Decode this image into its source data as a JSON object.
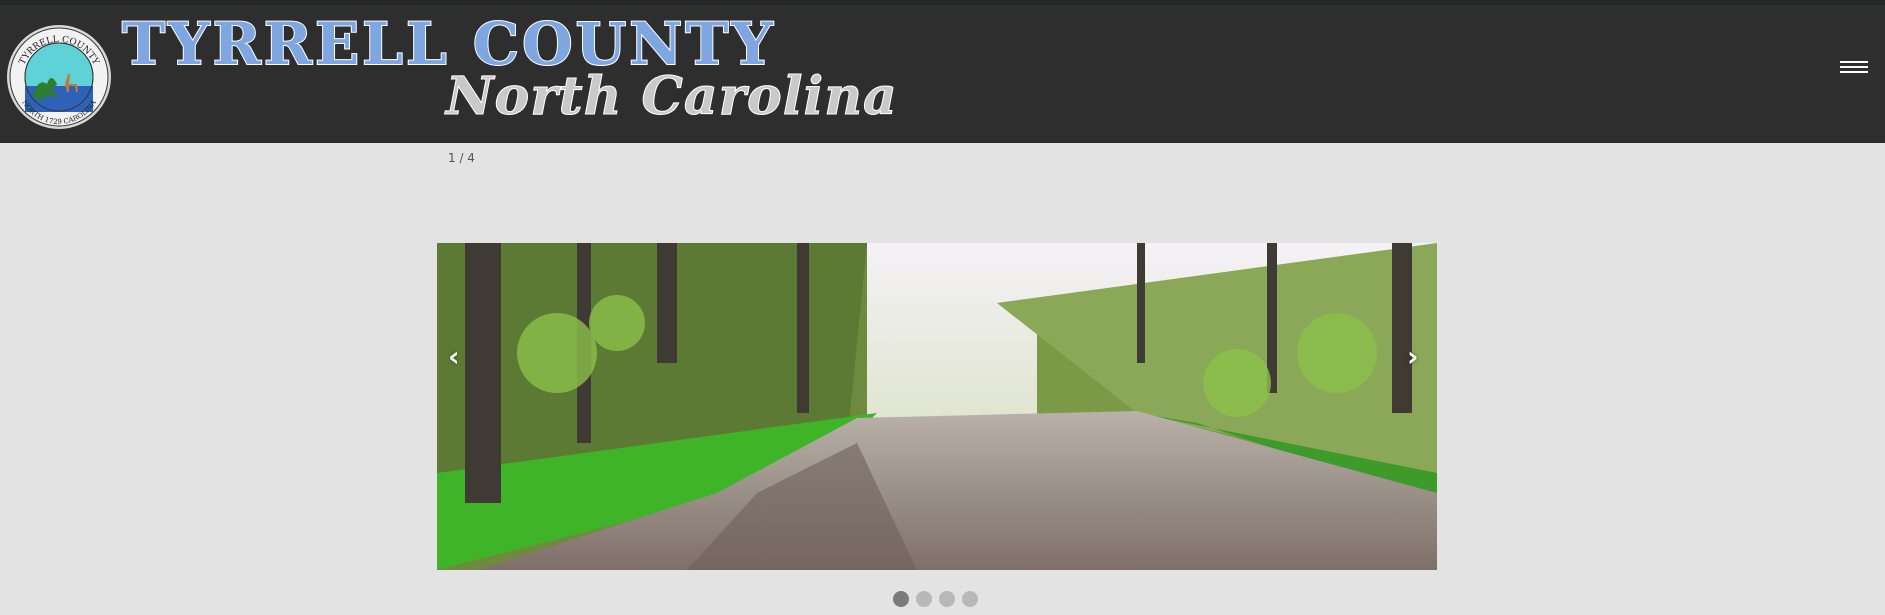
{
  "header": {
    "title": "TYRRELL COUNTY",
    "subtitle": "North Carolina",
    "seal": {
      "top_text": "TYRRELL COUNTY",
      "bottom_text": "NORTH 1729 CAROLINA"
    }
  },
  "menu": {
    "icon": "hamburger-menu-icon"
  },
  "slideshow": {
    "counter": "1 / 4",
    "prev_label": "‹",
    "next_label": "›",
    "dots": 4,
    "active_index": 0
  },
  "colors": {
    "header_bg": "#2e2e2e",
    "page_bg": "#e3e3e3",
    "title_fill": "#7ea6e0"
  }
}
